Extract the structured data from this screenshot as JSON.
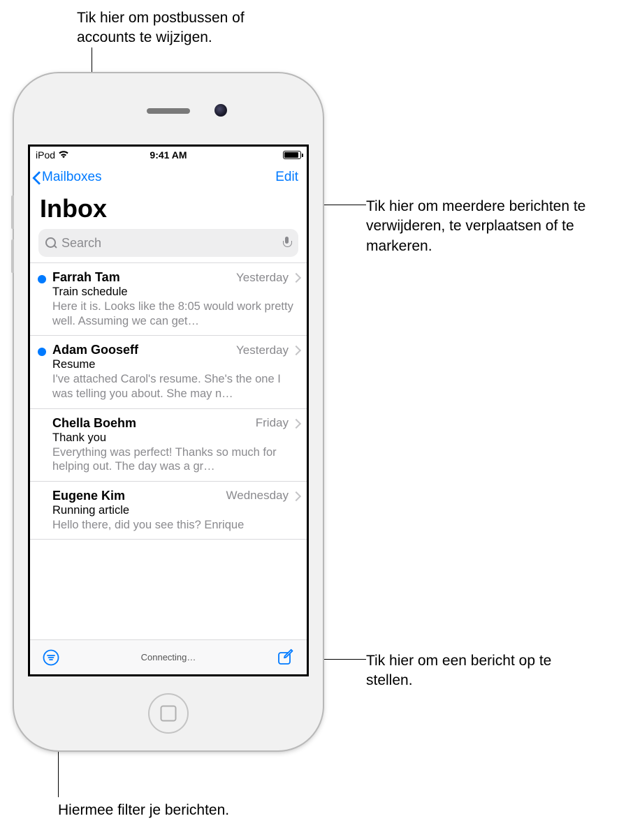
{
  "callouts": {
    "topLeft": "Tik hier om postbussen of accounts te wijzigen.",
    "topRight": "Tik hier om meerdere berichten te verwijderen, te verplaatsen of te markeren.",
    "bottomRight": "Tik hier om een bericht op te stellen.",
    "bottomLeft": "Hiermee filter je berichten."
  },
  "statusBar": {
    "carrier": "iPod",
    "time": "9:41 AM"
  },
  "nav": {
    "back": "Mailboxes",
    "edit": "Edit"
  },
  "title": "Inbox",
  "search": {
    "placeholder": "Search"
  },
  "messages": [
    {
      "unread": true,
      "sender": "Farrah Tam",
      "date": "Yesterday",
      "subject": "Train schedule",
      "preview": "Here it is. Looks like the 8:05 would work pretty well. Assuming we can get…"
    },
    {
      "unread": true,
      "sender": "Adam Gooseff",
      "date": "Yesterday",
      "subject": "Resume",
      "preview": "I've attached Carol's resume. She's the one I was telling you about. She may n…"
    },
    {
      "unread": false,
      "sender": "Chella Boehm",
      "date": "Friday",
      "subject": "Thank you",
      "preview": "Everything was perfect! Thanks so much for helping out. The day was a gr…"
    },
    {
      "unread": false,
      "sender": "Eugene Kim",
      "date": "Wednesday",
      "subject": "Running article",
      "preview": "Hello there, did you see this? Enrique"
    }
  ],
  "toolbar": {
    "status": "Connecting…"
  }
}
